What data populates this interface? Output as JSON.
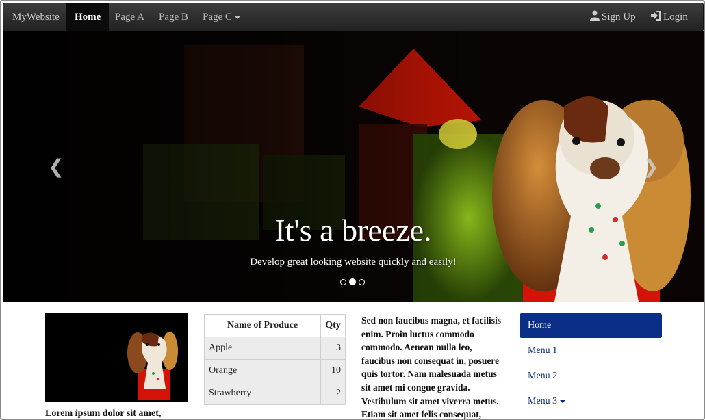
{
  "navbar": {
    "brand": "MyWebsite",
    "items": [
      {
        "label": "Home",
        "active": true
      },
      {
        "label": "Page A",
        "active": false
      },
      {
        "label": "Page B",
        "active": false
      },
      {
        "label": "Page C",
        "active": false,
        "dropdown": true
      }
    ],
    "right": [
      {
        "label": "Sign Up",
        "icon": "user-icon"
      },
      {
        "label": "Login",
        "icon": "login-icon"
      }
    ]
  },
  "carousel": {
    "title": "It's a breeze.",
    "subtitle": "Develop great looking website quickly and easily!",
    "prev_icon": "chevron-left-icon",
    "next_icon": "chevron-right-icon",
    "indicators": 3,
    "active_index": 1
  },
  "content": {
    "thumb_caption": "Lorem ipsum dolor sit amet,",
    "table": {
      "headers": [
        "Name of Produce",
        "Qty"
      ],
      "rows": [
        {
          "name": "Apple",
          "qty": "3"
        },
        {
          "name": "Orange",
          "qty": "10"
        },
        {
          "name": "Strawberry",
          "qty": "2"
        }
      ]
    },
    "paragraph": "Sed non faucibus magna, et facilisis enim. Proin luctus commodo commodo. Aenean nulla leo, faucibus non consequat in, posuere quis tortor. Nam malesuada metus sit amet mi congue gravida. Vestibulum sit amet viverra metus. Etiam sit amet felis consequat,"
  },
  "sidenav": {
    "items": [
      {
        "label": "Home",
        "active": true
      },
      {
        "label": "Menu 1",
        "active": false
      },
      {
        "label": "Menu 2",
        "active": false
      },
      {
        "label": "Menu 3",
        "active": false,
        "dropdown": true
      }
    ]
  },
  "colors": {
    "navbar_bg": "#2b2b2b",
    "side_active": "#0b2e86",
    "side_link": "#0b2e7a"
  }
}
